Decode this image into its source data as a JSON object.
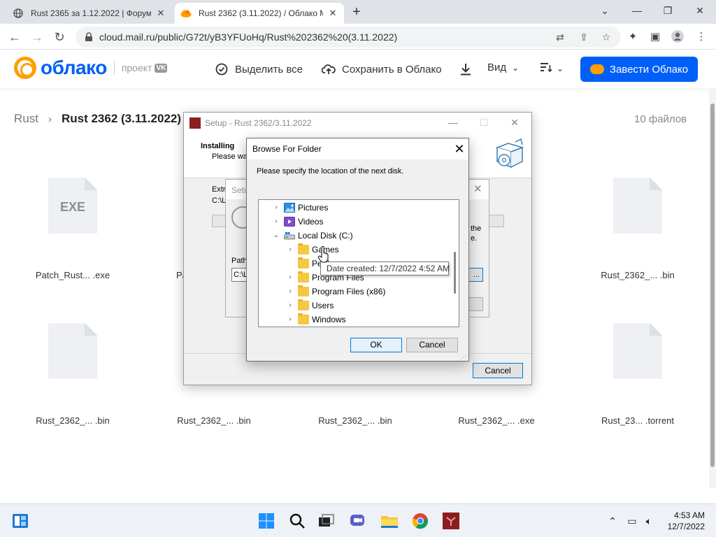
{
  "browser": {
    "tabs": [
      {
        "title": "Rust 2365 за 1.12.2022 | Форум о",
        "close": "✕"
      },
      {
        "title": "Rust 2362 (3.11.2022) / Облако M",
        "close": "✕"
      }
    ],
    "new_tab": "+",
    "url": "cloud.mail.ru/public/G72t/yB3YFUoHq/Rust%202362%20(3.11.2022)",
    "window_controls": {
      "minimize": "—",
      "maximize": "❐",
      "close": "✕"
    }
  },
  "cloud": {
    "logo_text": "облако",
    "logo_project": "проект",
    "logo_vk": "VK",
    "actions": {
      "select_all": "Выделить все",
      "save": "Сохранить в Облако",
      "view": "Вид"
    },
    "cta": "Завести Облако",
    "breadcrumb": {
      "root": "Rust",
      "arrow": "›",
      "current": "Rust 2362 (3.11.2022)"
    },
    "file_count": "10 файлов",
    "files_row1": [
      {
        "name": "Patch_Rust... .exe",
        "ext": "EXE"
      },
      {
        "name": "Pa",
        "ext": ""
      },
      {
        "name": "",
        "ext": ""
      },
      {
        "name": "in",
        "ext": ""
      },
      {
        "name": "Rust_2362_... .bin",
        "ext": ""
      }
    ],
    "files_row2": [
      {
        "name": "Rust_2362_... .bin"
      },
      {
        "name": "Rust_2362_... .bin"
      },
      {
        "name": "Rust_2362_... .bin"
      },
      {
        "name": "Rust_2362_... .exe"
      },
      {
        "name": "Rust_23... .torrent"
      }
    ]
  },
  "setup": {
    "title": "Setup - Rust 2362/3.11.2022",
    "installing": "Installing",
    "wait": "Please wai",
    "extract": "Extr",
    "path": "C:\\L",
    "cancel": "Cancel"
  },
  "setup2": {
    "title": "Setu",
    "the": "the",
    "e": "e.",
    "path_label": "Path",
    "path_value": "C:\\L",
    "browse": "..."
  },
  "browse_folder": {
    "title": "Browse For Folder",
    "instruction": "Please specify the location of the next disk.",
    "tree": [
      {
        "label": "Pictures",
        "chev": "›",
        "icon": "pictures",
        "indent": 0
      },
      {
        "label": "Videos",
        "chev": "›",
        "icon": "videos",
        "indent": 0
      },
      {
        "label": "Local Disk (C:)",
        "chev": "⌄",
        "icon": "drive",
        "indent": 0
      },
      {
        "label": "Games",
        "chev": "›",
        "icon": "folder",
        "indent": 1
      },
      {
        "label": "PerfLogs",
        "chev": "",
        "icon": "folder",
        "indent": 1
      },
      {
        "label": "Program Files",
        "chev": "›",
        "icon": "folder",
        "indent": 1
      },
      {
        "label": "Program Files (x86)",
        "chev": "›",
        "icon": "folder",
        "indent": 1
      },
      {
        "label": "Users",
        "chev": "›",
        "icon": "folder",
        "indent": 1
      },
      {
        "label": "Windows",
        "chev": "›",
        "icon": "folder",
        "indent": 1
      }
    ],
    "tooltip": "Date created: 12/7/2022 4:52 AM",
    "ok": "OK",
    "cancel": "Cancel"
  },
  "taskbar": {
    "time": "4:53 AM",
    "date": "12/7/2022"
  },
  "colors": {
    "accent": "#005ff9",
    "brand_orange": "#ff9e00"
  }
}
